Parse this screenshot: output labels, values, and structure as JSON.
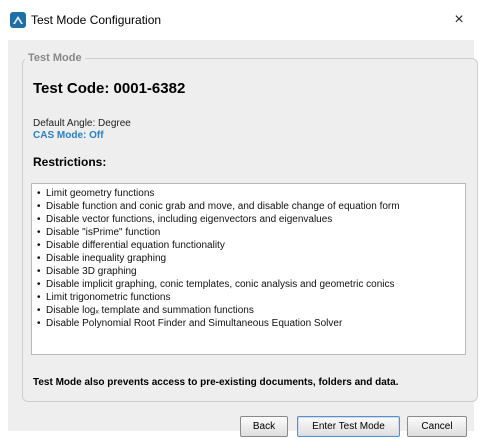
{
  "window": {
    "title": "Test Mode Configuration",
    "close_glyph": "×",
    "app_icon": "app-logo-icon"
  },
  "group": {
    "legend": "Test Mode"
  },
  "test_code": "Test Code: 0001-6382",
  "default_angle": "Default Angle: Degree",
  "cas_mode": "CAS Mode: Off",
  "restrictions": {
    "title": "Restrictions:",
    "items": [
      "Limit geometry functions",
      "Disable function and conic grab and move, and disable change of equation form",
      "Disable vector functions, including eigenvectors and eigenvalues",
      "Disable \"isPrime\" function",
      "Disable differential equation functionality",
      "Disable inequality graphing",
      "Disable 3D graphing",
      "Disable implicit graphing, conic templates, conic analysis and geometric conics",
      "Limit trigonometric functions",
      "Disable logₓ template and summation functions",
      "Disable Polynomial Root Finder and Simultaneous Equation Solver"
    ]
  },
  "footnote": "Test Mode also prevents access to pre-existing documents, folders and data.",
  "buttons": {
    "back": "Back",
    "enter": "Enter Test Mode",
    "cancel": "Cancel"
  },
  "colors": {
    "accent": "#2e7fc0",
    "dialog_bg": "#eeeeee"
  }
}
